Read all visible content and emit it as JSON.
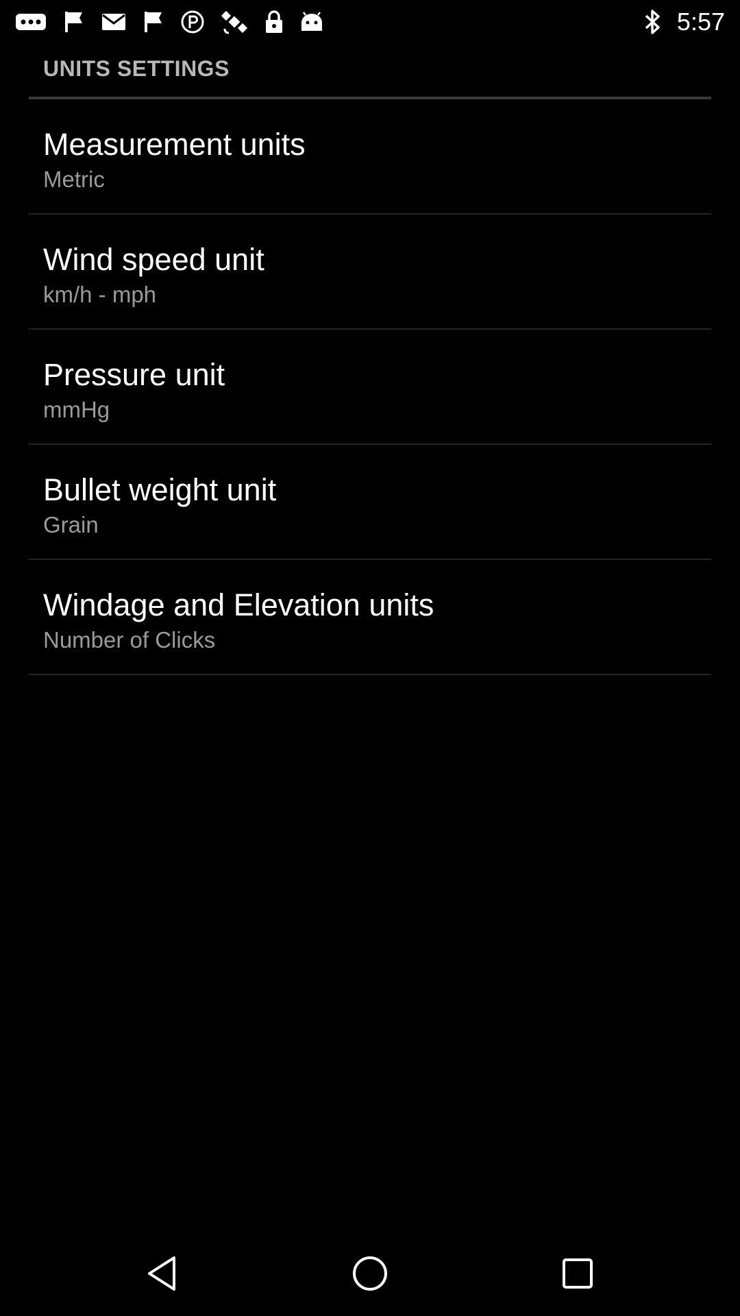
{
  "status_bar": {
    "time": "5:57",
    "left_icons": [
      "more-icon",
      "flag-icon",
      "mail-icon",
      "flag-icon",
      "circle-p-icon",
      "satellite-icon",
      "lock-icon",
      "android-icon"
    ],
    "right_icons": [
      "bluetooth-icon"
    ]
  },
  "screen": {
    "section_title": "UNITS SETTINGS"
  },
  "settings": [
    {
      "title": "Measurement units",
      "summary": "Metric"
    },
    {
      "title": "Wind speed unit",
      "summary": "km/h - mph"
    },
    {
      "title": "Pressure unit",
      "summary": "mmHg"
    },
    {
      "title": "Bullet weight unit",
      "summary": "Grain"
    },
    {
      "title": "Windage and Elevation units",
      "summary": "Number of Clicks"
    }
  ],
  "nav_bar": {
    "buttons": [
      "back-icon",
      "home-icon",
      "recents-icon"
    ]
  },
  "colors": {
    "background": "#000000",
    "title_text": "#ffffff",
    "summary_text": "#9a9a9a",
    "header_text": "#b8b8b8",
    "divider": "#262626"
  }
}
